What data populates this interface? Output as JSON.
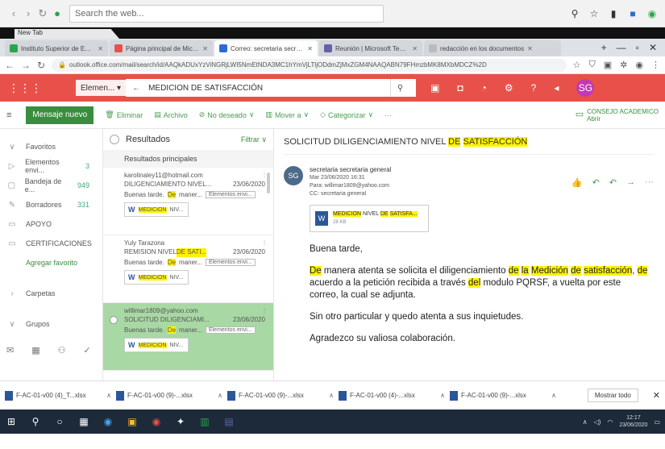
{
  "outer": {
    "search_placeholder": "Search the web...",
    "tab_label": "New Tab"
  },
  "browser_tabs": [
    {
      "label": "Instituto Superior de Educaci",
      "color": "#2aa54b"
    },
    {
      "label": "Página principal de Microsoft",
      "color": "#e8514a"
    },
    {
      "label": "Correo: secretaria secretaria g",
      "color": "#2b6cd4",
      "active": true
    },
    {
      "label": "Reunión | Microsoft Teams",
      "color": "#6264a7"
    },
    {
      "label": "redacción en los documentos",
      "color": "#bbb"
    }
  ],
  "address": {
    "url": "outlook.office.com/mail/search/id/AAQkADUxYzViNGRjLWI5NmEtNDA3MC1hYmVjLTljODdmZjMxZGM4NAAQABN79FHmzbMK8MXbMDCZ%2D"
  },
  "header": {
    "mailbox": "Elemen...",
    "search_value": "MEDICION DE SATISFACCIÓN",
    "avatar": "SG"
  },
  "command": {
    "new_message": "Mensaje nuevo",
    "delete": "Eliminar",
    "archive": "Archivo",
    "junk": "No deseado",
    "move": "Mover a",
    "categorize": "Categorizar",
    "more": "···",
    "right_label": "CONSEJO ACADEMICO",
    "right_sub": "Abrir"
  },
  "nav": [
    {
      "label": "Favoritos",
      "icon": "∨",
      "count": ""
    },
    {
      "label": "Elementos envi...",
      "icon": "▷",
      "count": "3"
    },
    {
      "label": "Bandeja de e...",
      "icon": "▢",
      "count": "949"
    },
    {
      "label": "Borradores",
      "icon": "✎",
      "count": "331"
    },
    {
      "label": "APOYO",
      "icon": "▭",
      "count": ""
    },
    {
      "label": "CERTIFICACIONES",
      "icon": "▭",
      "count": ""
    },
    {
      "label": "Agregar favorito",
      "icon": "",
      "count": "",
      "green": true
    },
    {
      "label": "Carpetas",
      "icon": "›",
      "count": ""
    },
    {
      "label": "Grupos",
      "icon": "∨",
      "count": ""
    }
  ],
  "list": {
    "title": "Resultados",
    "filter": "Filtrar",
    "section": "Resultados principales",
    "items": [
      {
        "from": "karolinaley11@hotmail.com",
        "subject": "DILIGENCIAMIENTO NIVEL...",
        "date": "23/06/2020",
        "prefix": "Buenas tarde.",
        "hl": "De",
        "rest": " maner...",
        "pill": "Elementos envi...",
        "attach": "MEDICION",
        "attach_rest": " NIV..."
      },
      {
        "from": "Yuly Tarazona",
        "subject": "REMISION NIVEL ",
        "subject_hl": "DE SATI...",
        "date": "23/06/2020",
        "prefix": "Buenas tarde.",
        "hl": "De",
        "rest": " maner...",
        "pill": "Elementos envi...",
        "attach": "MEDICION",
        "attach_rest": " NIV..."
      },
      {
        "from": "willimar1809@yahoo.com",
        "subject": "SOLICITUD DILIGENCIAMI...",
        "date": "23/06/2020",
        "prefix": "Buenas tarde.",
        "hl": "De",
        "rest": " maner...",
        "pill": "Elementos envi...",
        "attach": "MEDICION",
        "attach_rest": " NIV...",
        "selected": true
      }
    ]
  },
  "reading": {
    "subject_pre": "SOLICITUD DILIGENCIAMIENTO NIVEL ",
    "subject_hl1": "DE",
    "subject_sp": " ",
    "subject_hl2": "SATISFACCIÓN",
    "sender_initials": "SG",
    "sender_name": "secretaria secretaria general",
    "sender_date": "Mar 23/06/2020 16:31",
    "to": "Para: willimar1809@yahoo.com",
    "cc": "CC: secretaria general",
    "attach_hl1": "MEDICION",
    "attach_mid": " NIVEL ",
    "attach_hl2": "DE",
    "attach_sp": " ",
    "attach_hl3": "SATISFA...",
    "attach_size": "28 KB",
    "greeting": "Buena tarde,",
    "p1": [
      {
        "t": "De",
        "h": true
      },
      {
        "t": " manera atenta se solicita el diligenciamiento "
      },
      {
        "t": "de",
        "h": true
      },
      {
        "t": " "
      },
      {
        "t": "la",
        "h": true
      },
      {
        "t": " "
      },
      {
        "t": "Medición",
        "h": true
      },
      {
        "t": " "
      },
      {
        "t": "de",
        "h": true
      },
      {
        "t": " "
      },
      {
        "t": "satisfacción",
        "h": true
      },
      {
        "t": ", "
      },
      {
        "t": "de",
        "h": true
      },
      {
        "t": " acuerdo a la petición recibida  a través "
      },
      {
        "t": "del",
        "h": true
      },
      {
        "t": " modulo PQRSF, a vuelta por este correo, la cual se adjunta."
      }
    ],
    "p2": "Sin otro particular y quedo atenta a sus inquietudes.",
    "p3": "Agradezco su valiosa colaboración."
  },
  "downloads": [
    {
      "name": "F-AC-01-v00 (4)_T...xlsx"
    },
    {
      "name": "F-AC-01-v00 (9)-...xlsx"
    },
    {
      "name": "F-AC-01-v00 (9)-...xlsx"
    },
    {
      "name": "F-AC-01-v00 (4)-...xlsx"
    },
    {
      "name": "F-AC-01-v00 (9)-...xlsx"
    }
  ],
  "show_all": "Mostrar todo",
  "taskbar": {
    "time": "12:17",
    "date": "23/06/2020"
  }
}
